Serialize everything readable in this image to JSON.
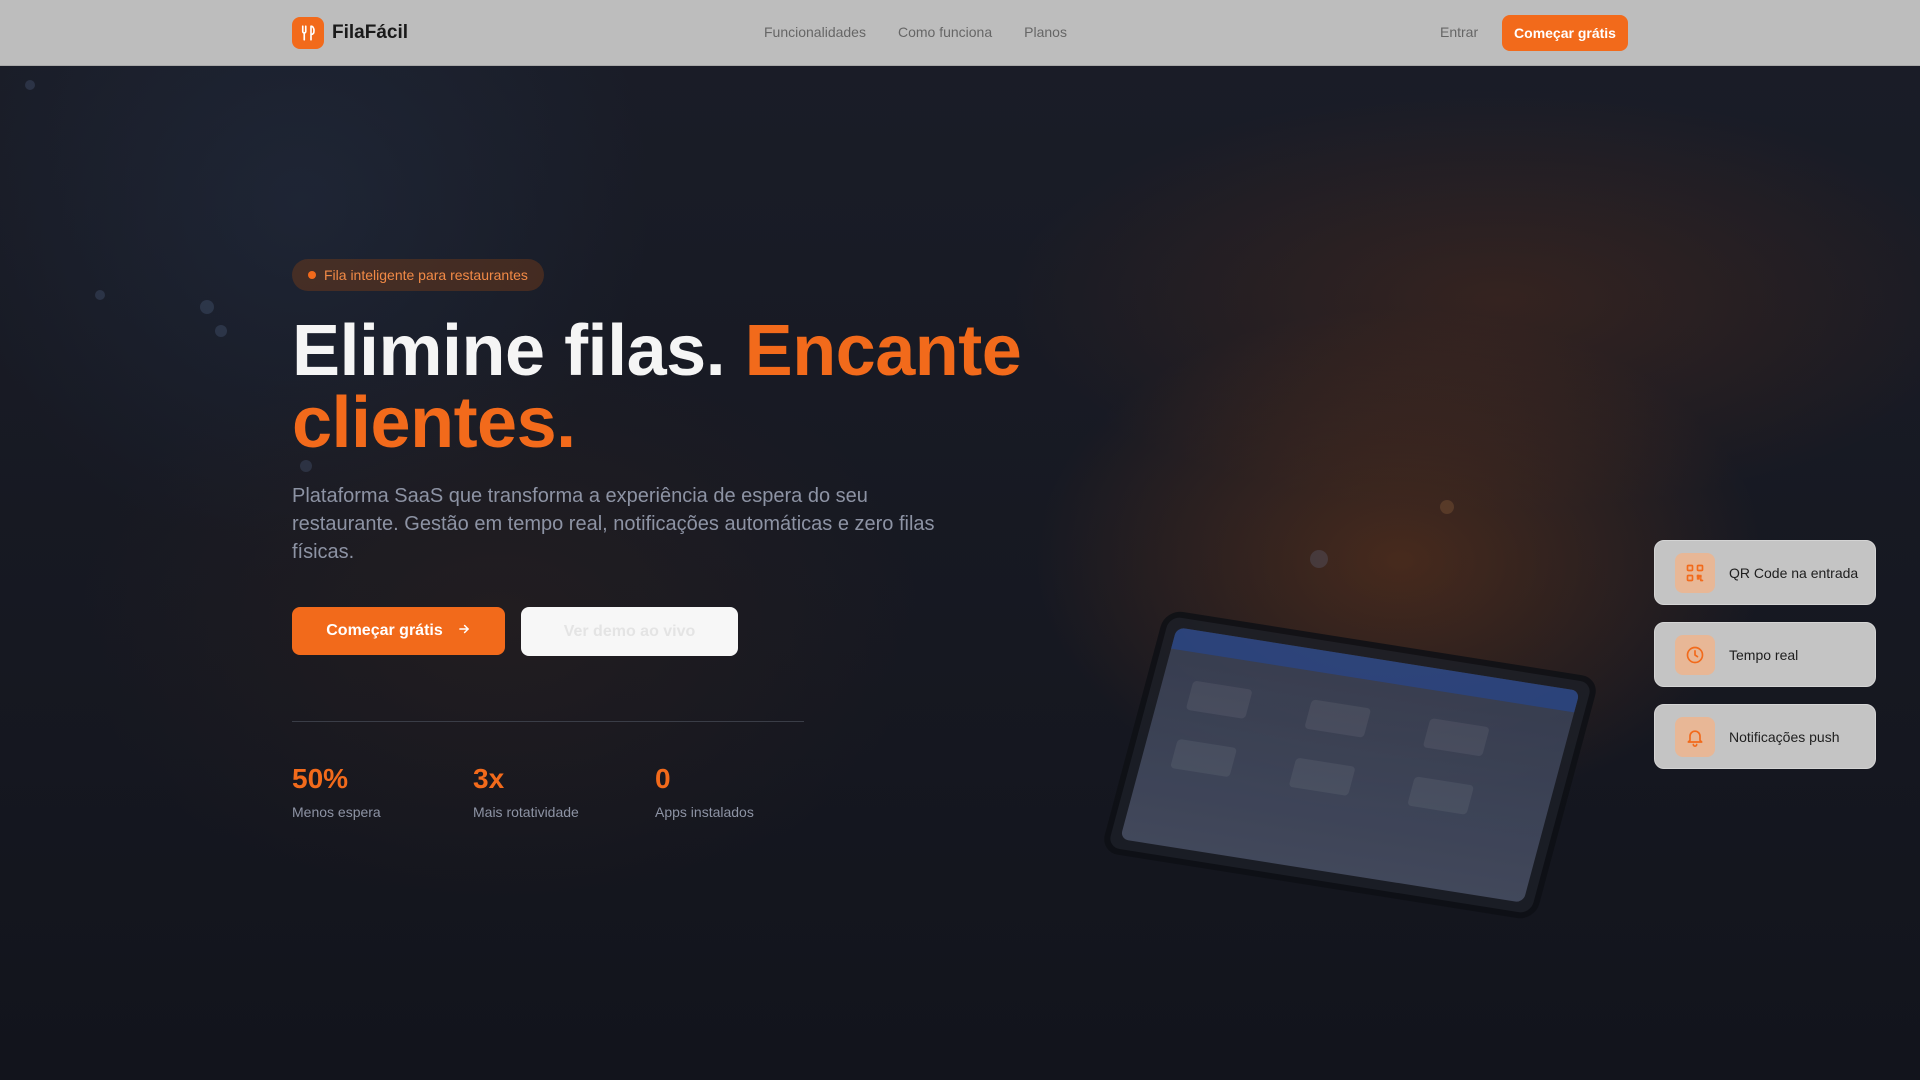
{
  "navbar": {
    "brand": "FilaFácil",
    "links": [
      "Funcionalidades",
      "Como funciona",
      "Planos"
    ],
    "login": "Entrar",
    "cta": "Começar grátis"
  },
  "hero": {
    "badge": "Fila inteligente para restaurantes",
    "headline_white": "Elimine filas. ",
    "headline_orange": "Encante clientes.",
    "subtitle": "Plataforma SaaS que transforma a experiência de espera do seu restaurante. Gestão em tempo real, notificações automáticas e zero filas físicas.",
    "primary_button": "Começar grátis",
    "secondary_button": "Ver demo ao vivo"
  },
  "stats": [
    {
      "value": "50%",
      "label": "Menos espera"
    },
    {
      "value": "3x",
      "label": "Mais rotatividade"
    },
    {
      "value": "0",
      "label": "Apps instalados"
    }
  ],
  "features": [
    {
      "label": "QR Code na entrada",
      "icon": "qr-code-icon"
    },
    {
      "label": "Tempo real",
      "icon": "clock-icon"
    },
    {
      "label": "Notificações push",
      "icon": "bell-icon"
    }
  ],
  "colors": {
    "accent": "#f26a1b",
    "background": "#12141c",
    "navbar": "#bdbdbd"
  }
}
